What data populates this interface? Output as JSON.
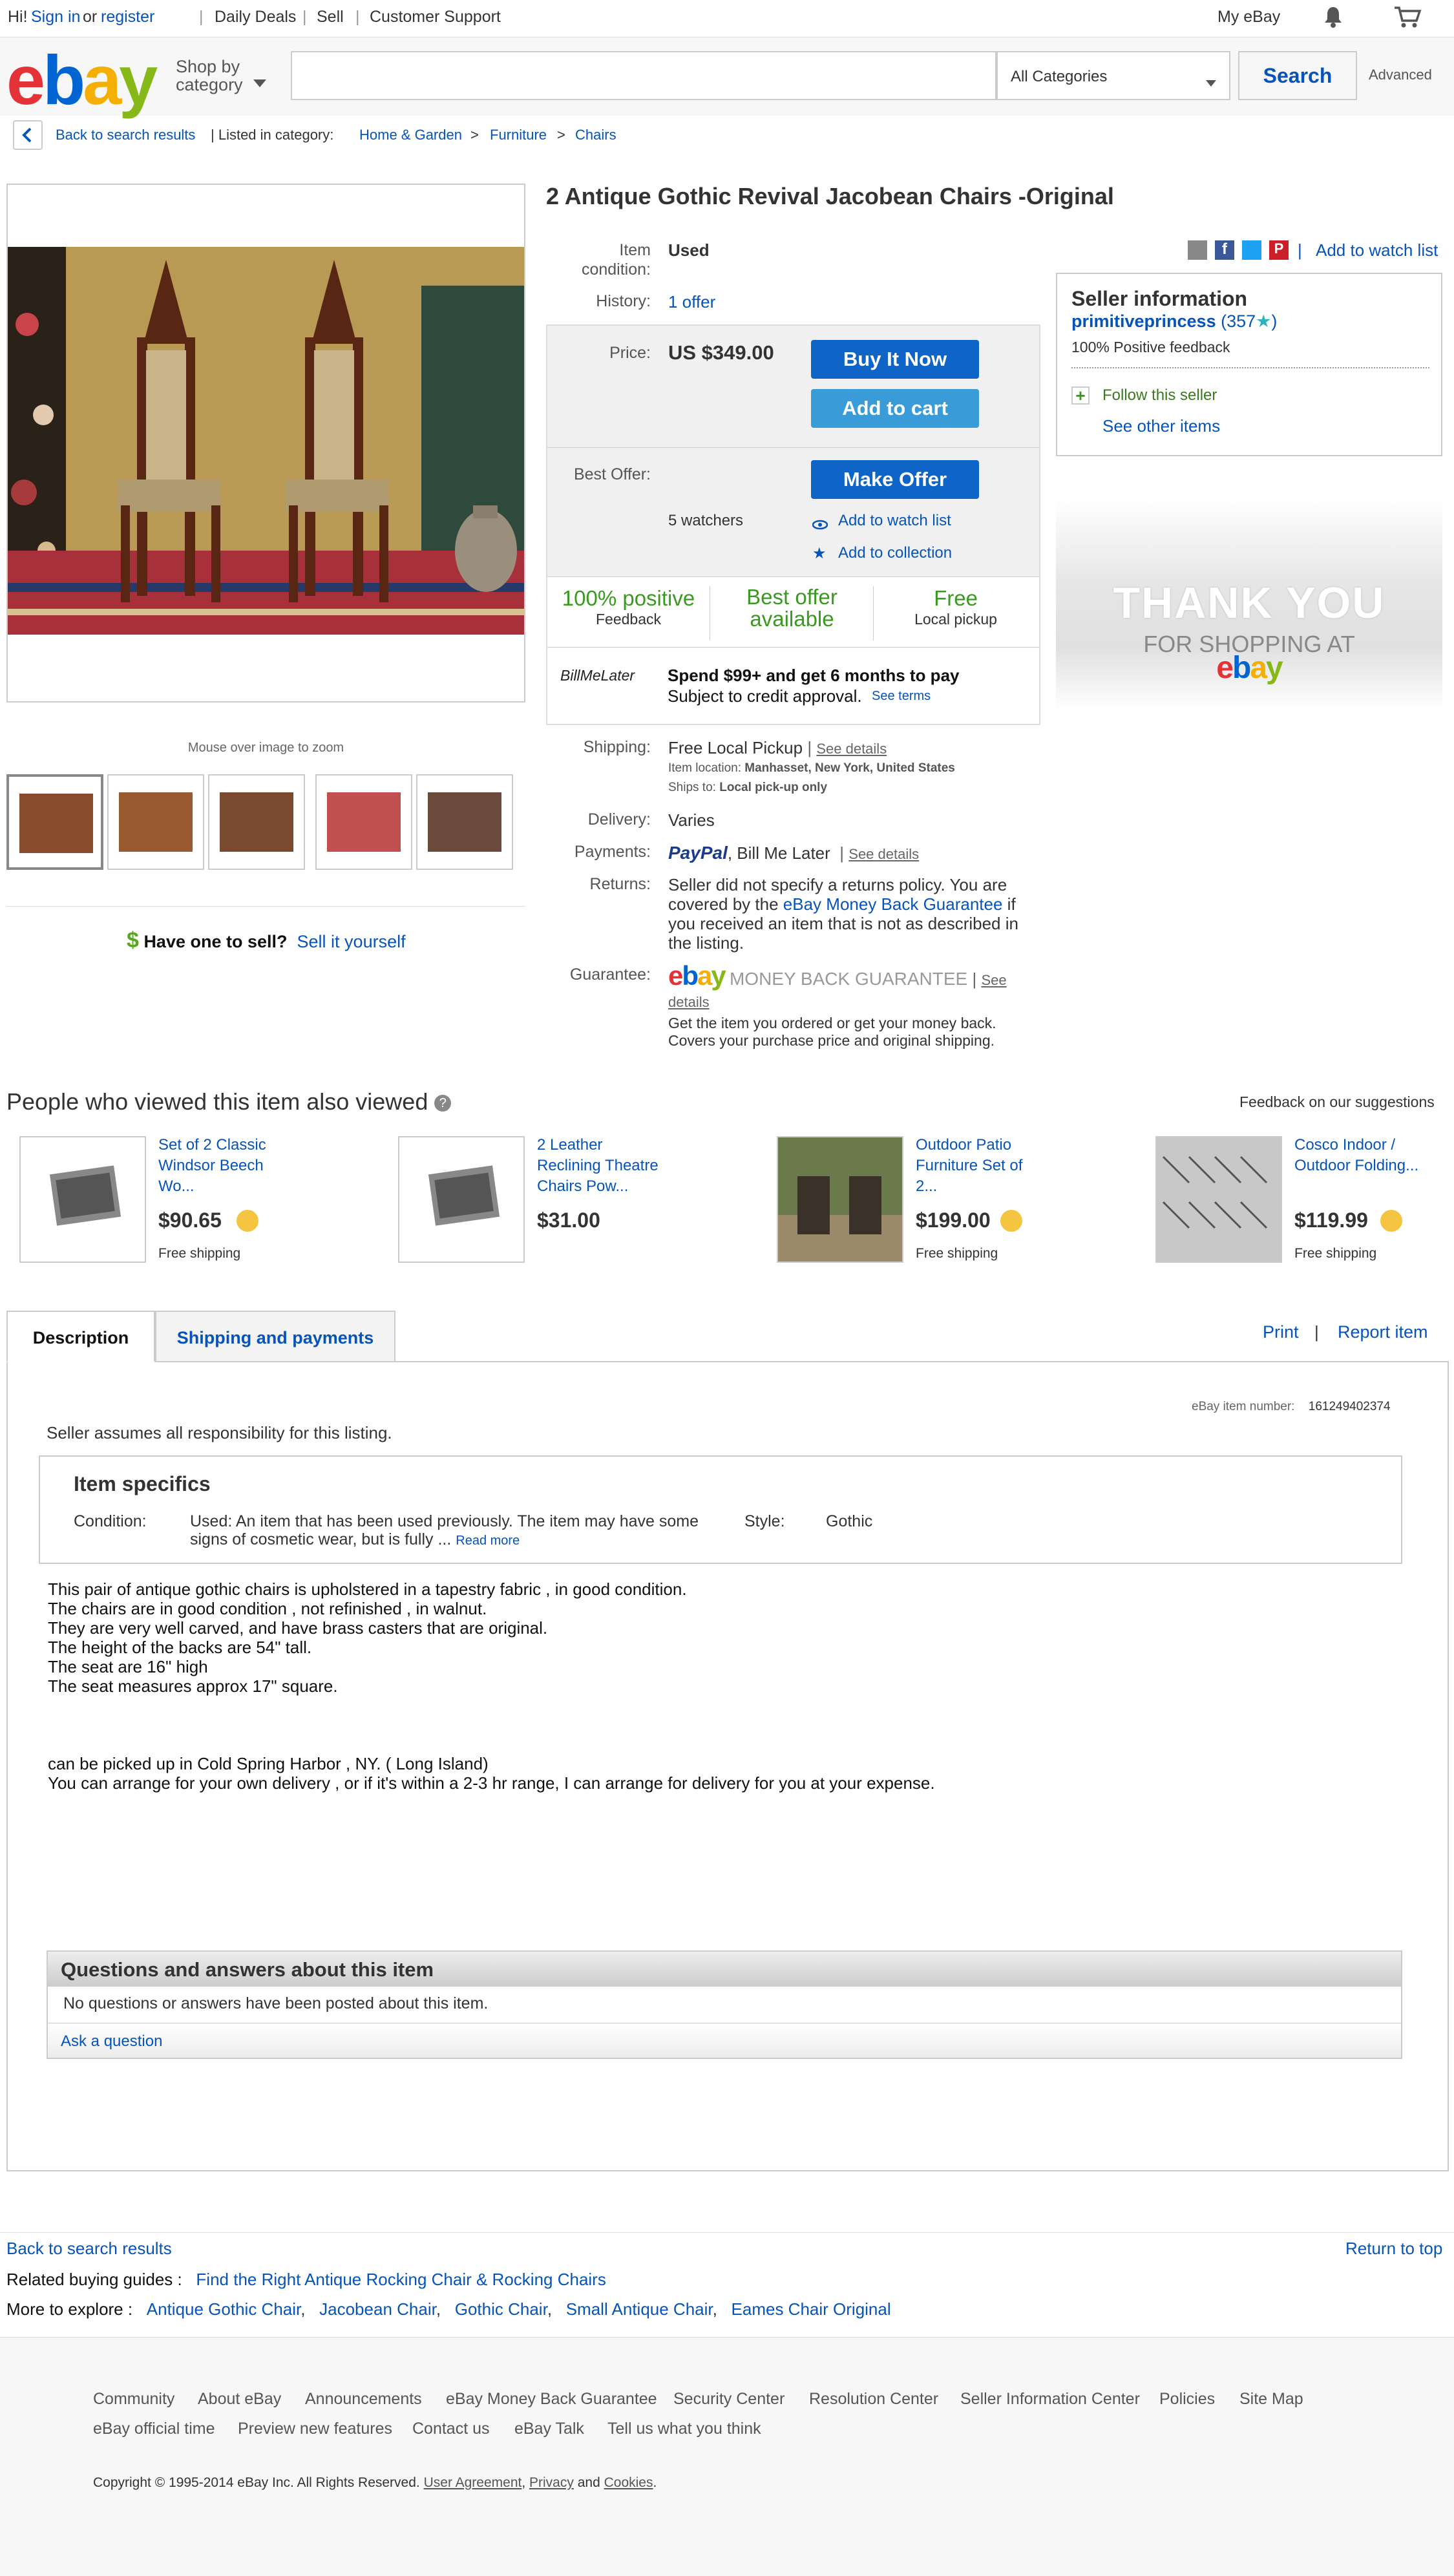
{
  "topbar": {
    "greeting": "Hi!",
    "sign_in": "Sign in",
    "or": "or",
    "register": "register",
    "daily_deals": "Daily Deals",
    "sell": "Sell",
    "customer_support": "Customer Support",
    "my_ebay": "My eBay"
  },
  "header": {
    "shop_by_category": "Shop by category",
    "search_placeholder": "",
    "category_selected": "All Categories",
    "search_button": "Search",
    "advanced": "Advanced"
  },
  "breadcrumb": {
    "back": "Back to search results",
    "listed_in": "| Listed in category:",
    "path": [
      "Home & Garden",
      "Furniture",
      "Chairs"
    ]
  },
  "gallery": {
    "zoom_hint": "Mouse over image to zoom",
    "have_one": "Have one to sell?",
    "sell_it": "Sell it yourself"
  },
  "item": {
    "title": "2 Antique Gothic Revival Jacobean Chairs -Original",
    "condition_label": "Item condition:",
    "condition_value": "Used",
    "history_label": "History:",
    "history_value": "1 offer",
    "add_watch_list_top": "Add to watch list",
    "price_label": "Price:",
    "price_value": "US $349.00",
    "buy_now": "Buy It Now",
    "add_to_cart": "Add to cart",
    "best_offer_label": "Best Offer:",
    "make_offer": "Make Offer",
    "watchers": "5 watchers",
    "add_watch_list": "Add to watch list",
    "add_collection": "Add to collection",
    "badges": [
      {
        "top": "100% positive",
        "bottom": "Feedback"
      },
      {
        "top": "Best offer",
        "bottom": "available"
      },
      {
        "top": "Free",
        "bottom": "Local pickup"
      }
    ],
    "billmelater_logo": "BillMeLater",
    "billmelater_promo": "Spend $99+ and get 6 months to pay",
    "billmelater_sub": "Subject to credit approval.",
    "see_terms": "See terms",
    "shipping_label": "Shipping:",
    "shipping_value": "Free Local Pickup",
    "see_details": "See details",
    "item_location_label": "Item location:",
    "item_location": "Manhasset, New York, United States",
    "ships_to_label": "Ships to:",
    "ships_to": "Local pick-up only",
    "delivery_label": "Delivery:",
    "delivery_value": "Varies",
    "payments_label": "Payments:",
    "paypal": "PayPal",
    "payments_value": ", Bill Me Later",
    "returns_label": "Returns:",
    "returns_value_1": "Seller did not specify a returns policy. You are covered by the",
    "returns_link": "eBay Money Back Guarantee",
    "returns_value_2": "if you received an item that is not as described in the listing.",
    "guarantee_label": "Guarantee:",
    "guarantee_logo": "MONEY BACK GUARANTEE",
    "guarantee_text": "Get the item you ordered or get your money back. Covers your purchase price and original shipping."
  },
  "seller": {
    "heading": "Seller information",
    "name": "primitiveprincess",
    "score": "(357",
    "score_close": ")",
    "feedback": "100% Positive feedback",
    "follow": "Follow this seller",
    "other_items": "See other items"
  },
  "thankyou": {
    "line1": "THANK YOU",
    "line2": "FOR SHOPPING AT"
  },
  "also_viewed": {
    "heading": "People who viewed this item also viewed",
    "feedback_link": "Feedback on our suggestions",
    "items": [
      {
        "title": "Set of 2 Classic Windsor Beech Wo...",
        "price": "$90.65",
        "shipping": "Free shipping"
      },
      {
        "title": "2 Leather Reclining Theatre Chairs Pow...",
        "price": "$31.00",
        "shipping": ""
      },
      {
        "title": "Outdoor Patio Furniture Set of 2...",
        "price": "$199.00",
        "shipping": "Free shipping"
      },
      {
        "title": "Cosco Indoor / Outdoor Folding...",
        "price": "$119.99",
        "shipping": "Free shipping"
      }
    ]
  },
  "tabs": {
    "description": "Description",
    "shipping_payments": "Shipping and payments",
    "print": "Print",
    "report": "Report item"
  },
  "description": {
    "item_number_label": "eBay item number:",
    "item_number": "161249402374",
    "responsibility": "Seller assumes all responsibility for this listing.",
    "specs_heading": "Item specifics",
    "condition_label": "Condition:",
    "condition_value": "Used: An item that has been used previously. The item may have some signs of cosmetic wear, but is fully ...",
    "read_more": "Read more",
    "style_label": "Style:",
    "style_value": "Gothic",
    "body": [
      "This pair of antique gothic chairs is upholstered in a tapestry fabric , in good condition.",
      "The chairs are in good condition , not refinished , in walnut.",
      "They are very well carved, and have brass casters that are original.",
      "The height of the backs are 54\" tall.",
      "The seat are 16\" high",
      "The seat measures approx 17\" square."
    ],
    "pickup": [
      "can be picked up in Cold Spring Harbor , NY. ( Long Island)",
      "You can arrange for your own delivery , or if it's within a 2-3 hr range, I can arrange for delivery for you at your expense."
    ],
    "qa_heading": "Questions and answers about this item",
    "qa_empty": "No questions or answers have been posted about this item.",
    "ask_question": "Ask a question"
  },
  "bottom": {
    "back": "Back to search results",
    "return_top": "Return to top",
    "related_label": "Related buying guides :",
    "related_link": "Find the Right Antique Rocking Chair & Rocking Chairs",
    "explore_label": "More to explore :",
    "explore_links": [
      "Antique Gothic Chair",
      "Jacobean Chair",
      "Gothic Chair",
      "Small Antique Chair",
      "Eames Chair Original"
    ]
  },
  "footer": {
    "row1": [
      "Community",
      "About eBay",
      "Announcements",
      "eBay Money Back Guarantee",
      "Security Center",
      "Resolution Center",
      "Seller Information Center",
      "Policies",
      "Site Map"
    ],
    "row2": [
      "eBay official time",
      "Preview new features",
      "Contact us",
      "eBay Talk",
      "Tell us what you think"
    ],
    "copyright": "Copyright © 1995-2014 eBay Inc. All Rights Reserved.",
    "user_agreement": "User Agreement",
    "privacy": "Privacy",
    "and": "and",
    "cookies": "Cookies"
  },
  "colors": {
    "link": "#0654ba",
    "buy_button": "#0f64c8",
    "cart_button": "#3a9bd9",
    "green": "#3a9a1f"
  }
}
